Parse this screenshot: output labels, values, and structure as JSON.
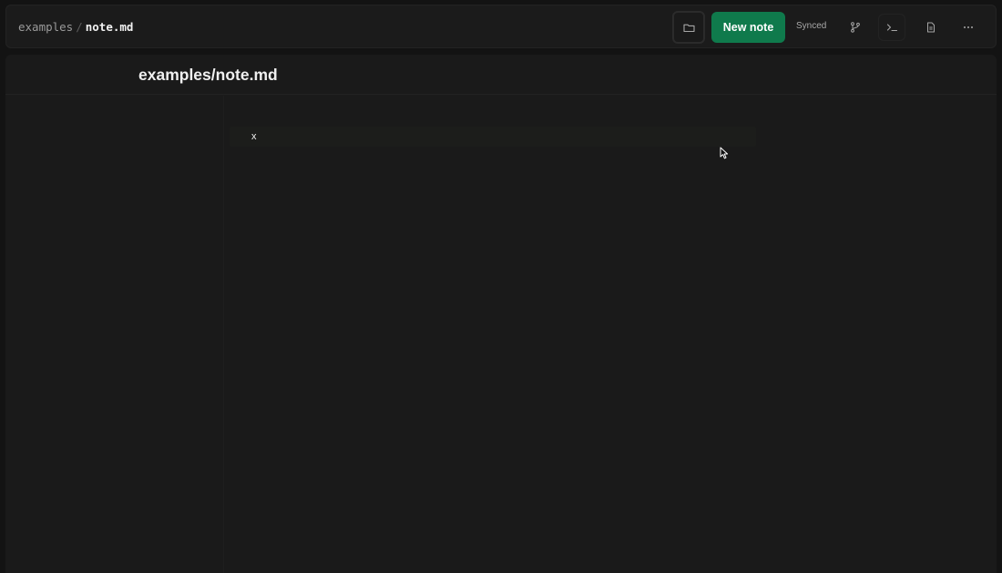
{
  "header": {
    "breadcrumb": {
      "folder": "examples",
      "separator": "/",
      "file": "note.md"
    },
    "folder_button_icon": "folder-icon",
    "new_note_label": "New note",
    "sync_status": "Synced",
    "actions": [
      {
        "icon": "git-branch-icon"
      },
      {
        "icon": "terminal-icon"
      },
      {
        "icon": "document-icon"
      },
      {
        "icon": "more-horizontal-icon"
      }
    ]
  },
  "document": {
    "title": "examples/note.md",
    "lines": [
      "x"
    ]
  },
  "colors": {
    "background": "#131313",
    "panel": "#1a1a1a",
    "accent": "#0f7a4c",
    "text": "#f0f0f0",
    "muted_text": "#9a9a9a"
  }
}
